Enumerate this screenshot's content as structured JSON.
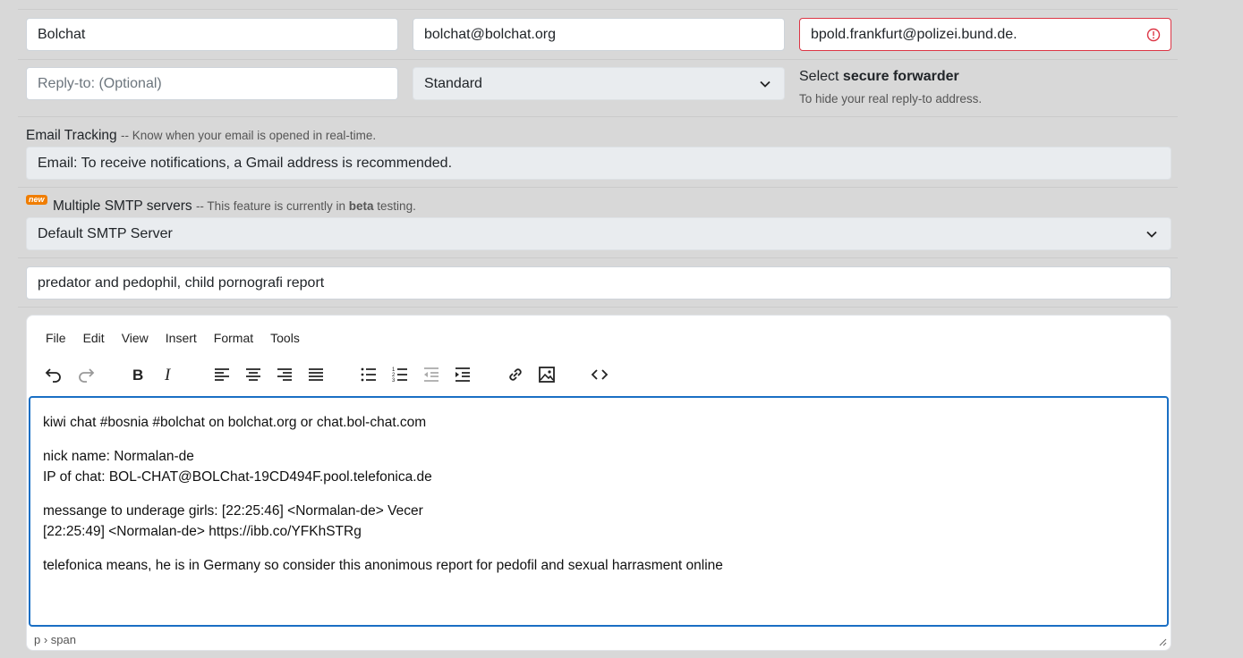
{
  "sender": {
    "name": "Bolchat",
    "email": "bolchat@bolchat.org",
    "to": "bpold.frankfurt@polizei.bund.de."
  },
  "reply_to": {
    "placeholder": "Reply-to: (Optional)",
    "forwarder_selected": "Standard",
    "forwarder_title_prefix": "Select",
    "forwarder_title_bold": "secure forwarder",
    "forwarder_hint": "To hide your real reply-to address."
  },
  "tracking": {
    "title": "Email Tracking",
    "hint": "-- Know when your email is opened in real-time.",
    "value": "Email: To receive notifications, a Gmail address is recommended."
  },
  "smtp": {
    "badge": "new",
    "title": "Multiple SMTP servers",
    "hint_prefix": "-- This feature is currently in",
    "hint_bold": "beta",
    "hint_suffix": "testing.",
    "selected": "Default SMTP Server"
  },
  "subject": "predator and pedophil, child pornografi report",
  "editor": {
    "menu": [
      "File",
      "Edit",
      "View",
      "Insert",
      "Format",
      "Tools"
    ],
    "toolbar_icons": [
      "undo-icon",
      "redo-icon",
      "bold-icon",
      "italic-icon",
      "align-left-icon",
      "align-center-icon",
      "align-right-icon",
      "align-justify-icon",
      "bullet-list-icon",
      "numbered-list-icon",
      "outdent-icon",
      "indent-icon",
      "link-icon",
      "image-icon",
      "source-code-icon"
    ],
    "paragraphs": [
      [
        "kiwi chat #bosnia #bolchat on bolchat.org or chat.bol-chat.com"
      ],
      [
        "nick name: Normalan-de",
        "IP of chat: BOL-CHAT@BOLChat-19CD494F.pool.telefonica.de"
      ],
      [
        "messange to underage girls: [22:25:46] <Normalan-de> Vecer",
        "[22:25:49] <Normalan-de> https://ibb.co/YFKhSTRg"
      ],
      [
        "telefonica means, he is in Germany so consider this anonimous report for pedofil and sexual harrasment online"
      ]
    ],
    "statusbar": "p › span"
  },
  "colors": {
    "error": "#dc3545",
    "focus": "#1a6fc4",
    "badge": "#f07d00",
    "background": "#d8d8d8"
  }
}
